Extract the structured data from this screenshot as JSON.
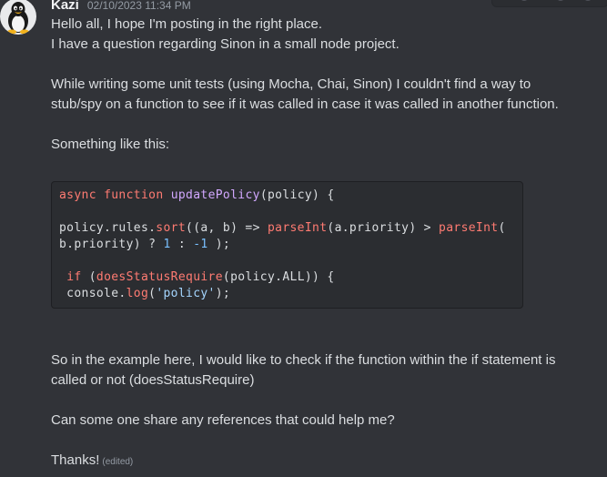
{
  "message": {
    "username": "Kazi",
    "timestamp": "02/10/2023 11:34 PM",
    "avatar_icon": "tux-penguin-icon",
    "paragraphs": {
      "p1": "Hello all, I hope I'm posting in the right place.",
      "p2": "I have a question regarding Sinon in a small node project.",
      "p3a": "While writing some unit tests (using Mocha, Chai, Sinon) I couldn't find a way to",
      "p3b": "stub/spy on a function to see if it was called in case it was called in another function.",
      "p4": "Something like this:",
      "p5a": "So in the example here, I would like to check if the function within the if statement is",
      "p5b": "called or not (doesStatusRequire)",
      "p6": "Can some one share any references that could help me?",
      "p7": "Thanks!"
    },
    "edited_label": "(edited)"
  },
  "code": {
    "line1": {
      "kw_async": "async",
      "kw_function": "function",
      "fn_name": "updatePolicy",
      "rest": "(policy) {"
    },
    "line2": {
      "pre": "policy.rules.",
      "sort": "sort",
      "mid": "((a, b) => ",
      "parse1": "parseInt",
      "mid2": "(a.priority) > ",
      "parse2": "parseInt",
      "end": "("
    },
    "line3": {
      "pre": "b.priority) ? ",
      "one": "1",
      "colon": " : ",
      "minus_one": "-1",
      "end": " );"
    },
    "line4": {
      "pre": " ",
      "kw_if": "if",
      "sp": " (",
      "fn": "doesStatusRequire",
      "rest": "(policy.ALL)) {"
    },
    "line5": {
      "pre": " console.",
      "log": "log",
      "open": "(",
      "str": "'policy'",
      "end": ");"
    }
  },
  "colors": {
    "background": "#313338",
    "code_background": "#2b2d31",
    "keyword": "#ff7b72",
    "function": "#d2a8ff",
    "number": "#79c0ff",
    "string": "#a5d6ff"
  }
}
